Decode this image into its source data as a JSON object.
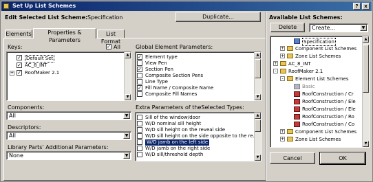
{
  "window": {
    "title": "Set Up List Schemes",
    "help_label": "?",
    "close_label": "x"
  },
  "header": {
    "edit_label": "Edit Selected List Scheme:",
    "scheme_name": "Specification",
    "duplicate_label": "Duplicate..."
  },
  "tabs": [
    {
      "label": "Elements"
    },
    {
      "label": "Properties & Parameters"
    },
    {
      "label": "List Format"
    }
  ],
  "keys": {
    "label": "Keys:",
    "all_label": "All",
    "items": [
      "Default Set",
      "AC_8_INT",
      "RoofMaker 2.1"
    ]
  },
  "components": {
    "label": "Components:",
    "value": "All"
  },
  "descriptors": {
    "label": "Descriptors:",
    "value": "All"
  },
  "library_parts": {
    "label": "Library Parts' Additional Parameters:",
    "value": "None"
  },
  "global_params": {
    "label": "Global Element Parameters:",
    "items": [
      {
        "label": "Element type",
        "checked": true
      },
      {
        "label": "View Pen",
        "checked": false
      },
      {
        "label": "Section Pen",
        "checked": true
      },
      {
        "label": "Composite Section Pens",
        "checked": false
      },
      {
        "label": "Line Type",
        "checked": false
      },
      {
        "label": "Fill Name / Composite Name",
        "checked": true
      },
      {
        "label": "Composite Fill Names",
        "checked": false
      }
    ]
  },
  "extra_params": {
    "label": "Extra Parameters of theSelected Types:",
    "items": [
      {
        "label": "Sill of the window/door",
        "checked": false
      },
      {
        "label": "W/D nominal sill height",
        "checked": false
      },
      {
        "label": "W/D sill height on the reveal side",
        "checked": false
      },
      {
        "label": "W/D sill height on the side opposite to the re...",
        "checked": false
      },
      {
        "label": "W/D jamb on the left side",
        "checked": false,
        "selected": true
      },
      {
        "label": "W/D jamb on the right side",
        "checked": false
      },
      {
        "label": "W/D sill/threshold depth",
        "checked": false
      }
    ]
  },
  "available": {
    "label": "Available List Schemes:",
    "delete_label": "Delete",
    "create_value": "Create...",
    "tree": [
      "Specification",
      "Component List Schemes",
      "Zone List Schemes",
      "AC_8_INT",
      "RoofMaker 2.1",
      "Element List Schemes",
      "Basic",
      "RoofConstruction / Cr",
      "RoofConstruction / Ele",
      "RoofConstruction / Ele",
      "RoofConstruction / Ro",
      "RoofConstruction / Co",
      "Component List Schemes",
      "Zone List Schemes"
    ]
  },
  "footer": {
    "cancel_label": "Cancel",
    "ok_label": "OK"
  },
  "colors": {
    "title_bar": "#0a246a",
    "selection": "#0a246a",
    "dialog_bg": "#d4d0c8"
  }
}
